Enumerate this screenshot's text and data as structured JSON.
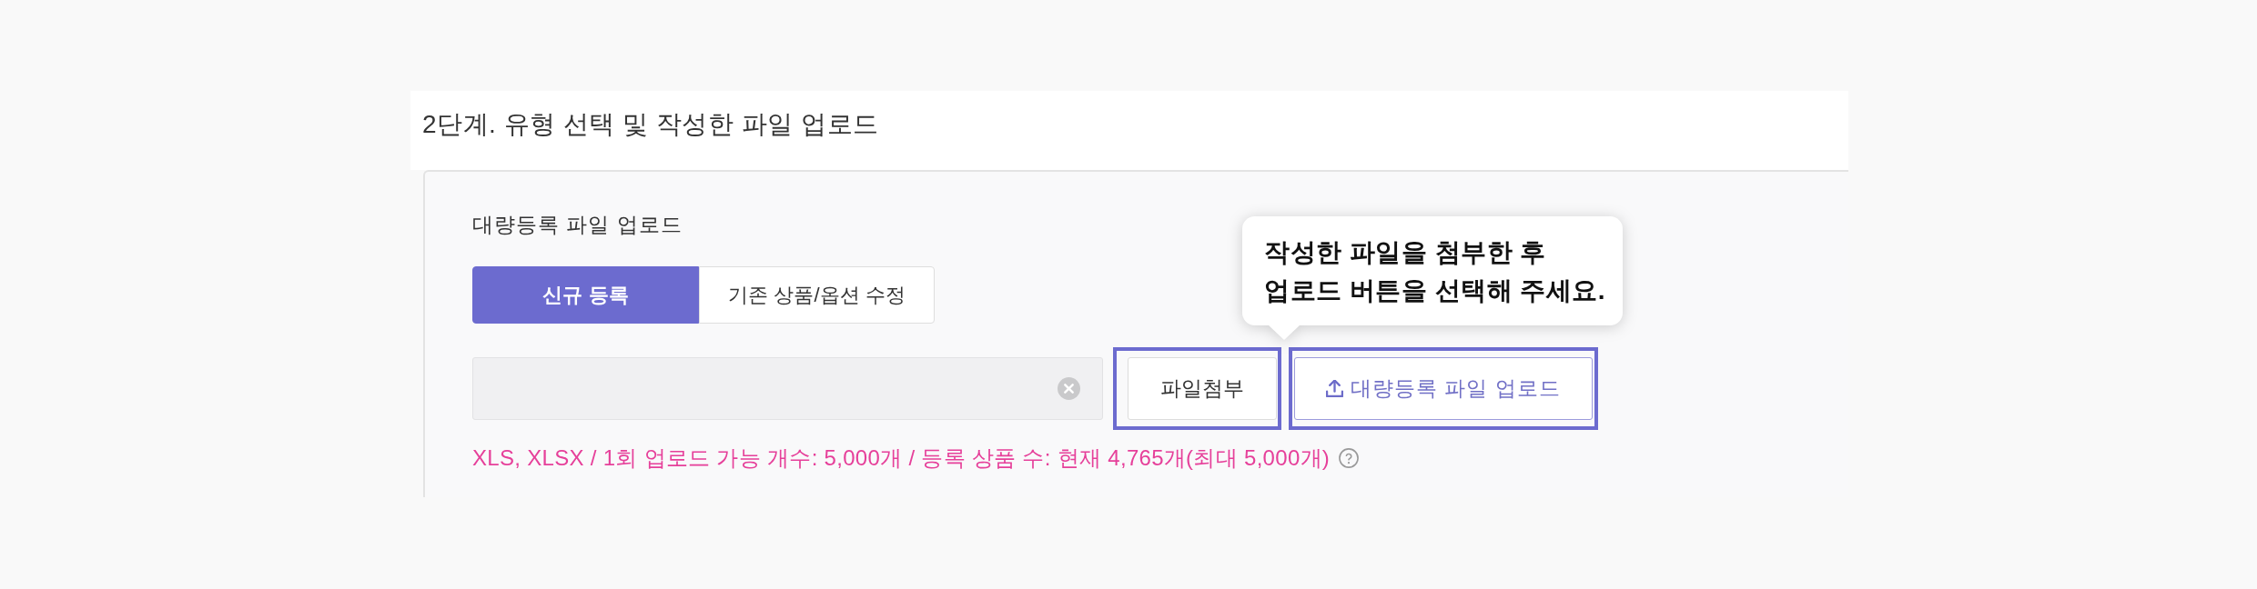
{
  "section": {
    "title": "2단계. 유형 선택 및 작성한 파일 업로드"
  },
  "upload": {
    "label": "대량등록 파일 업로드",
    "tabs": [
      {
        "label": "신규 등록",
        "selected": true
      },
      {
        "label": "기존 상품/옵션 수정",
        "selected": false
      }
    ],
    "buttons": [
      {
        "kind": "attach",
        "label": "파일첨부",
        "highlighted": true
      },
      {
        "kind": "upload",
        "label": "대량등록 파일 업로드",
        "highlighted": true
      }
    ],
    "note": "XLS, XLSX / 1회 업로드 가능 개수: 5,000개 / 등록 상품 수: 현재 4,765개(최대 5,000개)"
  },
  "tooltip": {
    "lines": [
      "작성한 파일을 첨부한 후",
      "업로드 버튼을 선택해 주세요."
    ]
  }
}
